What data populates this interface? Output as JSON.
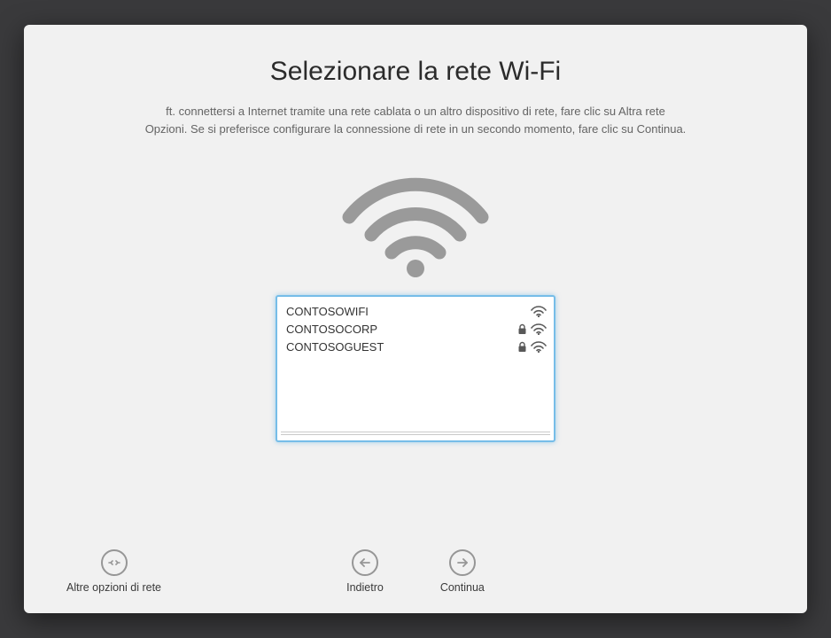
{
  "title": "Selezionare la rete Wi-Fi",
  "subtitle_line1": "ft. connettersi a Internet tramite una rete cablata o un altro dispositivo di rete, fare clic su Altra rete",
  "subtitle_line2": "Opzioni. Se si preferisce configurare la connessione di rete in un secondo momento, fare clic su Continua.",
  "networks": [
    {
      "name": "CONTOSOWIFI",
      "locked": false,
      "signal": true
    },
    {
      "name": "CONTOSOCORP",
      "locked": true,
      "signal": true
    },
    {
      "name": "CONTOSOGUEST",
      "locked": true,
      "signal": true
    }
  ],
  "buttons": {
    "other_options": "Altre opzioni di rete",
    "back": "Indietro",
    "continue": "Continua"
  }
}
